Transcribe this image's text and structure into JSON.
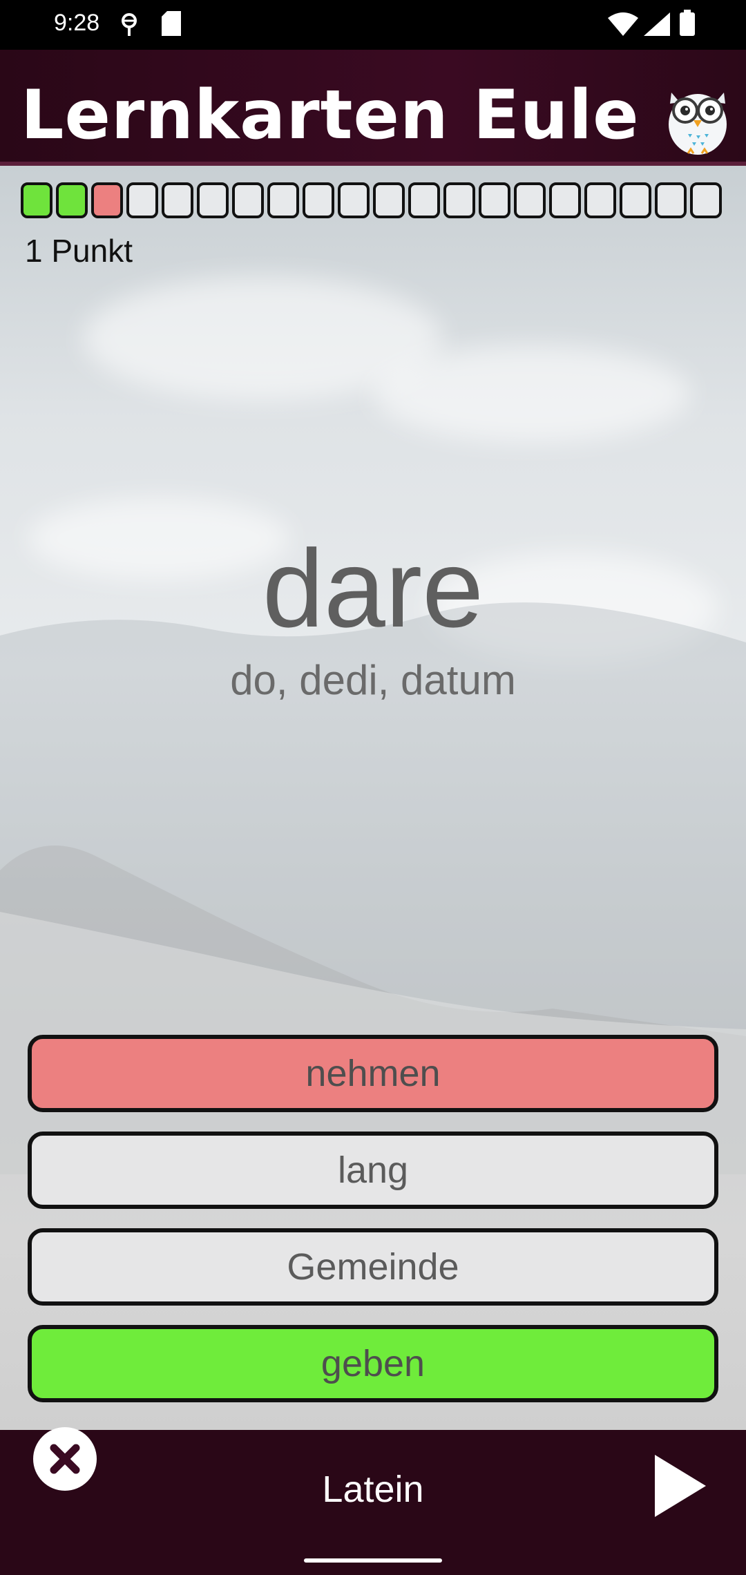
{
  "status_bar": {
    "time": "9:28",
    "icons": [
      "vpn-key-icon",
      "sd-card-icon",
      "wifi-icon",
      "signal-icon",
      "battery-icon"
    ]
  },
  "app_bar": {
    "title": "Lernkarten Eule",
    "logo": "owl-icon"
  },
  "progress": {
    "total_segments": 20,
    "states": [
      "correct",
      "correct",
      "wrong",
      "empty",
      "empty",
      "empty",
      "empty",
      "empty",
      "empty",
      "empty",
      "empty",
      "empty",
      "empty",
      "empty",
      "empty",
      "empty",
      "empty",
      "empty",
      "empty",
      "empty"
    ],
    "score_label": "1 Punkt",
    "colors": {
      "correct": "#6fe33c",
      "wrong": "#ec8080",
      "empty": "#e7e9eb"
    }
  },
  "card": {
    "word": "dare",
    "forms": "do, dedi, datum"
  },
  "answers": [
    {
      "label": "nehmen",
      "state": "wrong"
    },
    {
      "label": "lang",
      "state": "neutral"
    },
    {
      "label": "Gemeinde",
      "state": "neutral"
    },
    {
      "label": "geben",
      "state": "correct"
    }
  ],
  "bottom_bar": {
    "subject": "Latein",
    "close_icon": "close-icon",
    "next_icon": "play-icon"
  },
  "colors": {
    "brand_dark": "#2a0717",
    "correct": "#6fec3b",
    "wrong": "#ec8080"
  }
}
